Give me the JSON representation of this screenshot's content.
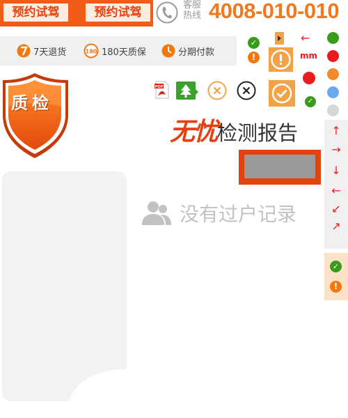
{
  "header": {
    "test_drive_button_1": "预约试驾",
    "test_drive_button_2": "预约试驾",
    "hotline_label_line1": "客服",
    "hotline_label_line2": "热线",
    "hotline_number": "4008-010-010"
  },
  "services": [
    {
      "icon": "number-7-icon",
      "label": "7天退货"
    },
    {
      "icon": "number-180-icon",
      "label": "180天质保"
    },
    {
      "icon": "clock-icon",
      "label": "分期付款"
    }
  ],
  "badge": {
    "label": "质检"
  },
  "report": {
    "title_emphasis": "无忧",
    "title_rest": "检测报告",
    "empty_text": "没有过户记录"
  },
  "sprites": {
    "unit_label": "mm"
  },
  "colors": {
    "brand_orange": "#f25c19",
    "hotline_orange": "#f0781e",
    "red": "#e81c1c",
    "green": "#3a9a1c",
    "gray_text": "#c2c2c2"
  }
}
